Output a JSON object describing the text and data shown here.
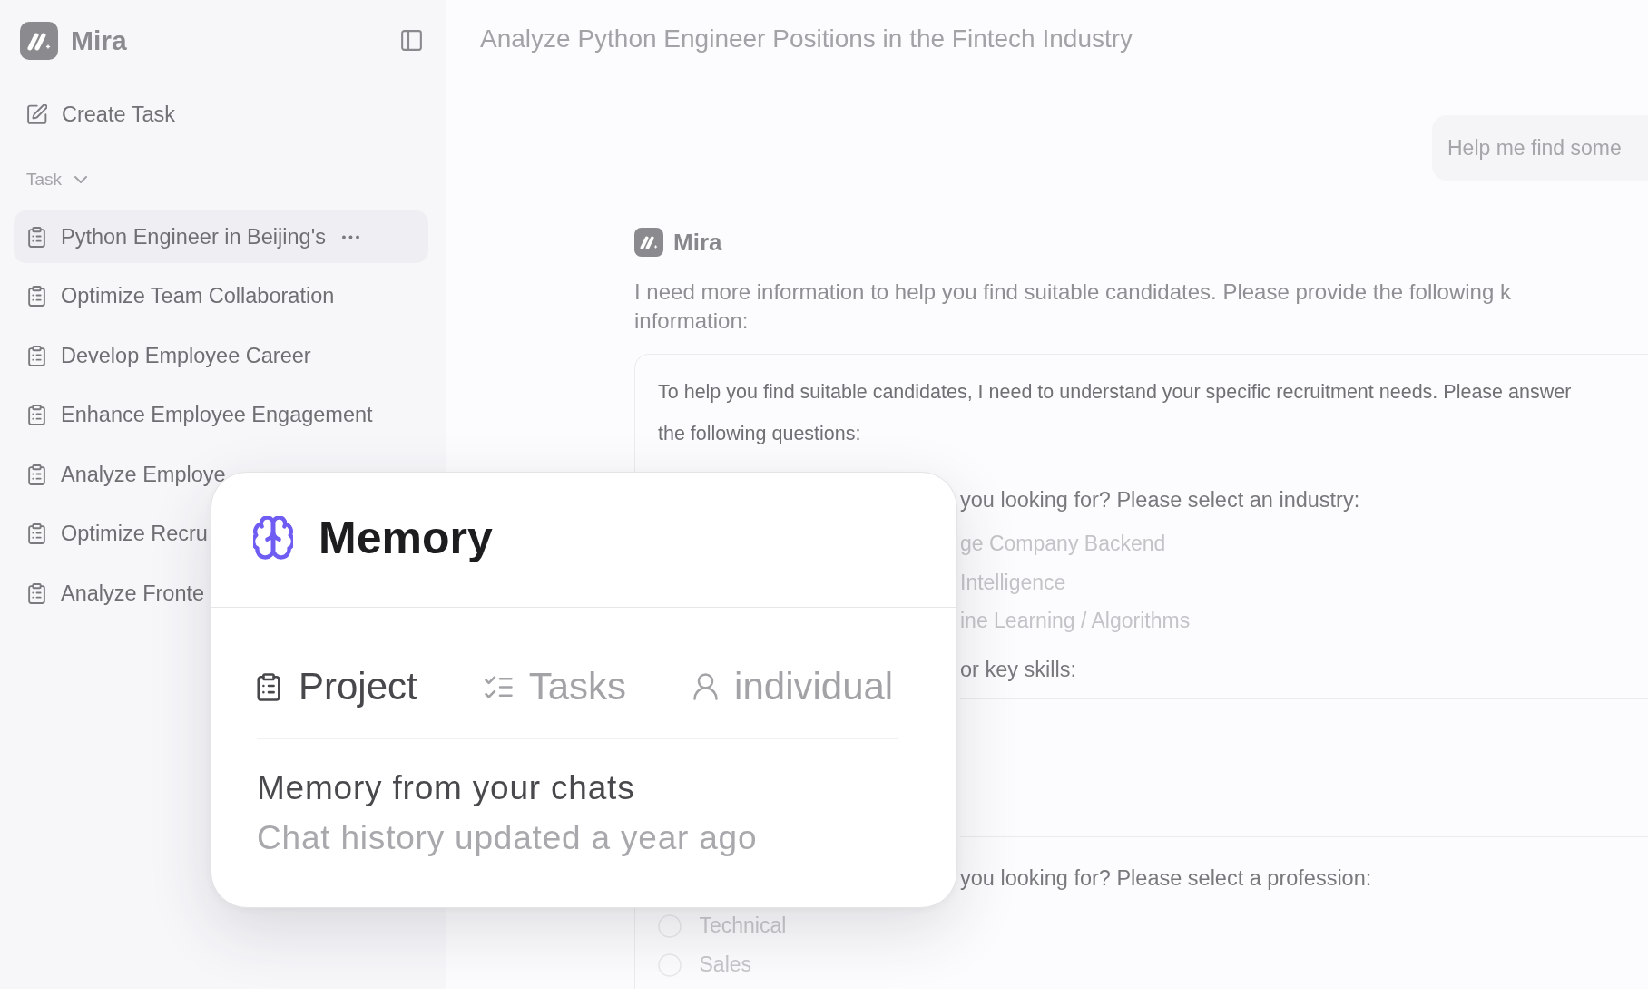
{
  "sidebar": {
    "brand": "Mira",
    "create_task": "Create Task",
    "section": {
      "label": "Task",
      "expanded": true
    },
    "items": [
      {
        "label": "Python Engineer in Beijing's",
        "selected": true
      },
      {
        "label": "Optimize Team Collaboration",
        "selected": false
      },
      {
        "label": "Develop Employee Career",
        "selected": false
      },
      {
        "label": "Enhance Employee Engagement",
        "selected": false
      },
      {
        "label": "Analyze Employe",
        "selected": false
      },
      {
        "label": "Optimize Recru",
        "selected": false
      },
      {
        "label": "Analyze Fronte",
        "selected": false
      }
    ]
  },
  "main": {
    "title": "Analyze Python Engineer Positions in the Fintech Industry",
    "user_message": "Help me find some",
    "assistant_name": "Mira",
    "message_lines": [
      "I need more information to help you find suitable candidates. Please provide the following k",
      "information:"
    ],
    "form": {
      "intro_lines": [
        "To help you find suitable candidates, I need to understand your specific recruitment needs. Please answer",
        "the following questions:"
      ],
      "questions": [
        {
          "kind": "choice",
          "text": "you looking for? Please select an industry:",
          "options": [
            {
              "label": "ge Company Backend"
            },
            {
              "label": "Intelligence"
            },
            {
              "label": "ine Learning / Algorithms"
            }
          ]
        },
        {
          "kind": "text",
          "text": "or key skills:"
        },
        {
          "kind": "choice",
          "text": "you looking for? Please select a profession:",
          "options": [
            {
              "label": "Technical",
              "selected": false
            },
            {
              "label": "Sales",
              "selected": false
            }
          ]
        }
      ]
    }
  },
  "memory_panel": {
    "title": "Memory",
    "tabs": [
      {
        "label": "Project",
        "selected": true
      },
      {
        "label": "Tasks",
        "selected": false
      },
      {
        "label": "individual",
        "selected": false
      }
    ],
    "heading": "Memory from your chats",
    "subtitle": "Chat history updated a year ago"
  }
}
